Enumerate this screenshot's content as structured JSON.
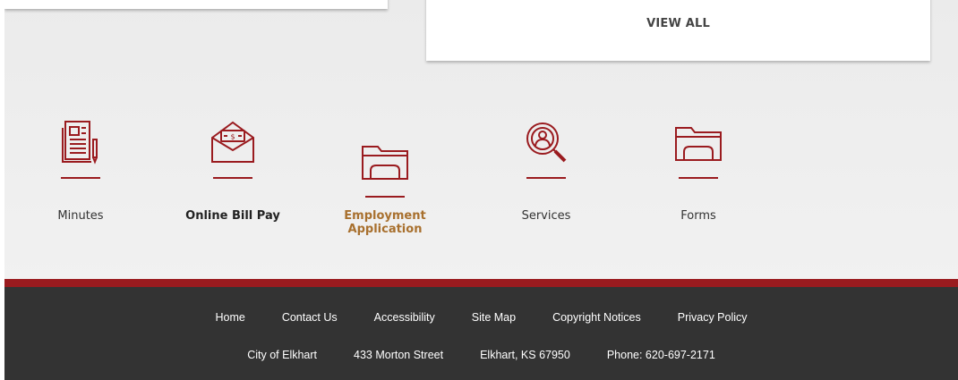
{
  "top": {
    "view_all": "VIEW ALL"
  },
  "quick_links": [
    {
      "label": "Minutes",
      "icon": "newspaper-icon"
    },
    {
      "label": "Online Bill Pay",
      "icon": "money-envelope-icon"
    },
    {
      "label": "Employment Application",
      "icon": "folder-icon"
    },
    {
      "label": "Services",
      "icon": "search-person-icon"
    },
    {
      "label": "Forms",
      "icon": "folder-icon"
    }
  ],
  "footer": {
    "links": [
      "Home",
      "Contact Us",
      "Accessibility",
      "Site Map",
      "Copyright Notices",
      "Privacy Policy"
    ],
    "info": {
      "name": "City of Elkhart",
      "address": "433 Morton Street",
      "city": "Elkhart, KS 67950",
      "phone": "Phone: 620-697-2171"
    }
  },
  "colors": {
    "accent_red": "#9a1b1f",
    "active_link": "#a8702e",
    "footer_bg": "#333333"
  }
}
